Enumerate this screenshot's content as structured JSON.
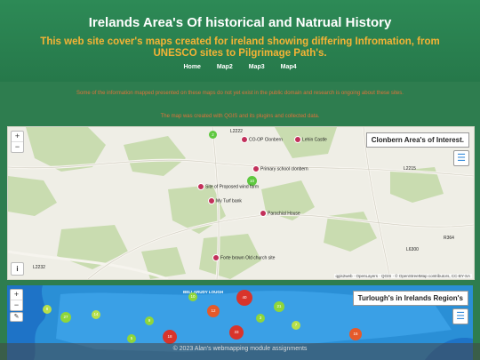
{
  "header": {
    "title": "Irelands Area's Of historical and Natrual History",
    "subtitle": "This web site cover's maps created for ireland showing differing Infromation, from UNESCO sites to Pilgrimage Path's."
  },
  "nav": {
    "items": [
      "Home",
      "Map2",
      "Map3",
      "Map4"
    ]
  },
  "intro": {
    "line1": "Some of the information mapped presented on these maps do not yet exist in the public domain and research is ongoing about these sites.",
    "line2": "The map was created with QGIS and its plugins and collected data."
  },
  "map1": {
    "title": "Clonbern Area's of Interest.",
    "places": [
      "CO-OP Clonbern",
      "Lehin Castle",
      "Primary school clonbern",
      "Site of Proposed wind farm",
      "My Turf bank",
      "Parochial House",
      "Forte brown Old church site"
    ],
    "road_labels": [
      "L2215",
      "L2232",
      "L6300",
      "R364",
      "L2222"
    ],
    "cluster_labels": [
      "2",
      "10"
    ],
    "attribution": "qgis2web · OpenLayers · QGIS · © OpenStreetMap contributors, CC-BY-SA"
  },
  "map2": {
    "title": "Turlough's in Irelands Region's",
    "place_label": "BELLARUDY LOUGH",
    "cluster_labels": [
      "10",
      "8",
      "27",
      "14",
      "9",
      "18",
      "12",
      "40",
      "3",
      "33",
      "21",
      "7",
      "15",
      "5"
    ]
  },
  "zoom": {
    "in": "+",
    "out": "−"
  },
  "footer": {
    "text": "© 2023 Alan's webmapping module assignments"
  },
  "colors": {
    "header_bg": "#2d8a56",
    "subtitle": "#f5b335",
    "intro_text": "#e0733a",
    "marker": "#c2305a",
    "sea": "#1e73c7"
  },
  "icons": {
    "info": "info-icon",
    "layers": "layers-icon"
  }
}
